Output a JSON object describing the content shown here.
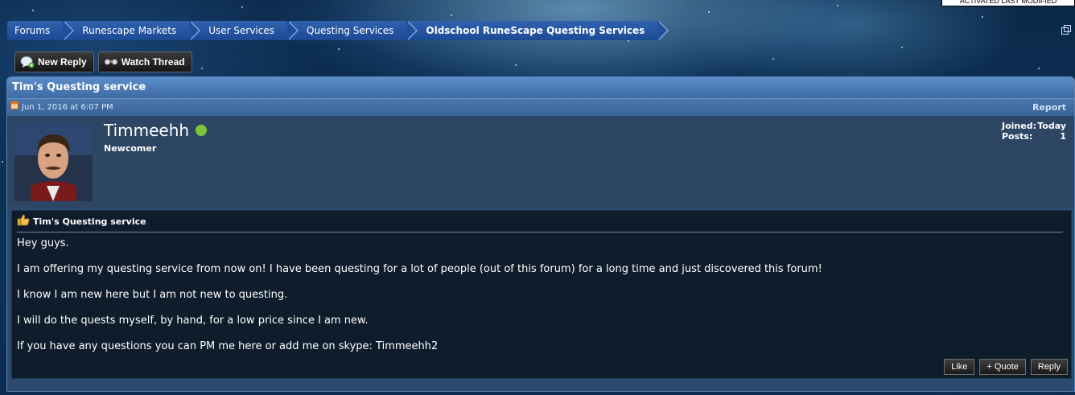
{
  "top_box": {
    "text": "ACTIVATED LAST MODIFIED"
  },
  "breadcrumb": [
    {
      "label": "Forums"
    },
    {
      "label": "Runescape Markets"
    },
    {
      "label": "User Services"
    },
    {
      "label": "Questing Services"
    },
    {
      "label": "Oldschool RuneScape Questing Services"
    }
  ],
  "thread_buttons": {
    "new_reply": "New Reply",
    "watch_thread": "Watch Thread"
  },
  "thread": {
    "title": "Tim's Questing service"
  },
  "post": {
    "date": "Jun 1, 2016 at 6:07 PM",
    "report": "Report",
    "user": {
      "name": "Timmeehh",
      "title": "Newcomer",
      "joined_label": "Joined:",
      "joined_value": "Today",
      "posts_label": "Posts:",
      "posts_value": "1"
    },
    "title": "Tim's Questing service",
    "paragraphs": [
      "Hey guys.",
      "I am offering my questing service from now on! I have been questing for a lot of people (out of this forum) for a long time and just discovered this forum!",
      "I know I am new here but I am not new to questing.",
      "I will do the quests myself, by hand, for a low price since I am new.",
      "If you have any questions you can PM me here or add me on skype: Timmeehh2"
    ],
    "actions": {
      "like": "Like",
      "quote": "+ Quote",
      "reply": "Reply"
    }
  },
  "colors": {
    "accent": "#2f62b0",
    "online": "#7cc43a",
    "panel": "#2c4a6e"
  }
}
